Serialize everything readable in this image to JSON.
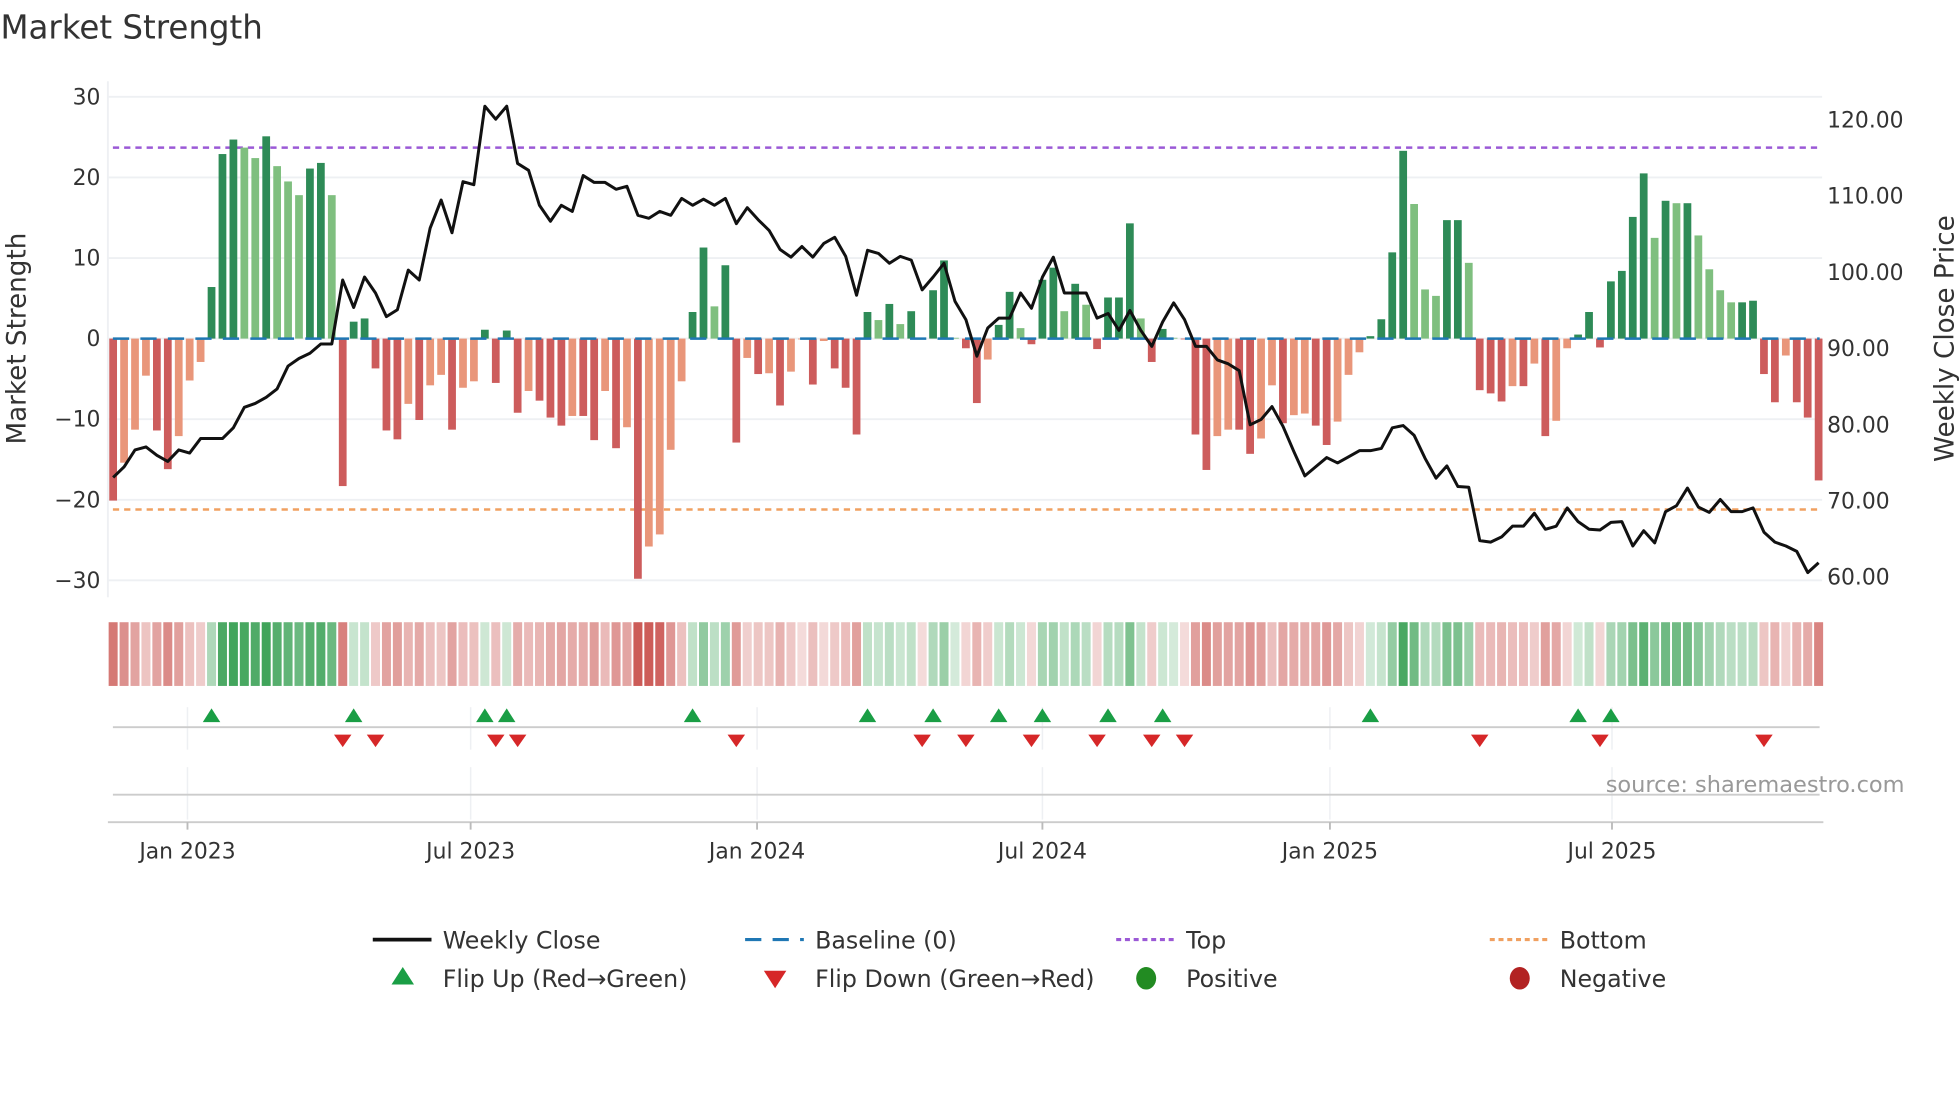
{
  "chart_data": {
    "type": "bar",
    "title": "Market Strength",
    "ylabel": "Market Strength",
    "y2label": "Weekly Close Price",
    "ylim": [
      -32,
      32
    ],
    "y2lim": [
      58,
      123
    ],
    "yticks": [
      30,
      20,
      10,
      0,
      -10,
      -20,
      -30
    ],
    "ytick_labels": [
      "30",
      "20",
      "10",
      "0",
      "−10",
      "−20",
      "−30"
    ],
    "y2ticks": [
      120,
      110,
      100,
      90,
      80,
      70,
      60
    ],
    "y2tick_labels": [
      "120.00",
      "110.00",
      "100.00",
      "90.00",
      "80.00",
      "70.00",
      "60.00"
    ],
    "x_unit": "week index",
    "xticks": [
      {
        "label": "Jan 2023",
        "week": 6.8
      },
      {
        "label": "Jul 2023",
        "week": 32.7
      },
      {
        "label": "Jan 2024",
        "week": 58.9
      },
      {
        "label": "Jul 2024",
        "week": 85.0
      },
      {
        "label": "Jan 2025",
        "week": 111.3
      },
      {
        "label": "Jul 2025",
        "week": 137.1
      }
    ],
    "grid": true,
    "top_level": 23.7,
    "bottom_level": -21.2,
    "baseline": 0,
    "strength": [
      -20.1,
      -15.4,
      -11.3,
      -4.6,
      -11.4,
      -16.2,
      -12.1,
      -5.2,
      -2.9,
      6.4,
      22.9,
      24.7,
      23.7,
      22.4,
      25.1,
      21.4,
      19.5,
      17.8,
      21.1,
      21.8,
      17.8,
      -18.3,
      2.1,
      2.5,
      -3.7,
      -11.4,
      -12.5,
      -8.1,
      -10.1,
      -5.8,
      -4.5,
      -11.3,
      -6.1,
      -5.3,
      1.1,
      -5.5,
      1.0,
      -9.2,
      -6.5,
      -7.7,
      -9.8,
      -10.8,
      -9.6,
      -9.6,
      -12.6,
      -6.5,
      -13.6,
      -11.0,
      -29.8,
      -25.8,
      -24.3,
      -13.8,
      -5.3,
      3.3,
      11.3,
      4.0,
      9.1,
      -12.9,
      -2.4,
      -4.4,
      -4.3,
      -8.3,
      -4.1,
      -0.1,
      -5.7,
      -0.3,
      -3.7,
      -6.1,
      -11.9,
      3.3,
      2.3,
      4.3,
      1.8,
      3.4,
      -0.1,
      6.0,
      9.7,
      0.1,
      -1.2,
      -8.0,
      -2.6,
      1.7,
      5.8,
      1.3,
      -0.7,
      7.3,
      8.8,
      3.4,
      6.8,
      4.2,
      -1.3,
      5.1,
      5.1,
      14.3,
      2.5,
      -2.9,
      1.2,
      0.1,
      -0.1,
      -11.9,
      -16.3,
      -12.1,
      -11.3,
      -11.3,
      -14.3,
      -12.4,
      -5.8,
      -10.5,
      -9.5,
      -9.3,
      -10.8,
      -13.2,
      -10.3,
      -4.5,
      -1.7,
      0.3,
      2.4,
      10.7,
      23.3,
      16.7,
      6.1,
      5.3,
      14.7,
      14.7,
      9.4,
      -6.4,
      -6.8,
      -7.8,
      -5.9,
      -5.9,
      -3.1,
      -12.1,
      -10.2,
      -1.2,
      0.5,
      3.3,
      -1.1,
      7.1,
      8.4,
      15.1,
      20.5,
      12.5,
      17.1,
      16.8,
      16.8,
      12.8,
      8.6,
      6.0,
      4.5,
      4.5,
      4.7,
      -4.4,
      -7.9,
      -2.1,
      -7.9,
      -9.8,
      -17.6
    ],
    "weekly_close": [
      73.1,
      74.5,
      76.7,
      77.1,
      76.0,
      75.2,
      76.7,
      76.3,
      78.2,
      78.2,
      78.2,
      79.6,
      82.3,
      82.8,
      83.6,
      84.7,
      87.7,
      88.7,
      89.4,
      90.6,
      90.6,
      99.0,
      95.4,
      99.4,
      97.3,
      94.2,
      95.1,
      100.3,
      99.0,
      105.8,
      109.5,
      105.2,
      111.9,
      111.5,
      121.8,
      120.1,
      121.8,
      114.3,
      113.4,
      108.8,
      106.7,
      108.8,
      108.0,
      112.7,
      111.8,
      111.8,
      110.9,
      111.3,
      107.5,
      107.1,
      108.0,
      107.5,
      109.7,
      108.8,
      109.6,
      108.8,
      109.7,
      106.4,
      108.5,
      106.9,
      105.5,
      103.0,
      102.0,
      103.4,
      102.0,
      103.8,
      104.6,
      102.1,
      97.0,
      102.9,
      102.5,
      101.2,
      102.1,
      101.6,
      97.7,
      99.4,
      101.2,
      96.2,
      93.8,
      89.0,
      92.7,
      94.0,
      94.0,
      97.3,
      95.3,
      99.4,
      102.0,
      97.3,
      97.3,
      97.3,
      94.0,
      94.6,
      92.4,
      95.0,
      92.4,
      90.3,
      93.5,
      96.0,
      93.8,
      90.3,
      90.3,
      88.5,
      88.0,
      87.1,
      80.0,
      80.7,
      82.4,
      79.8,
      76.5,
      73.3,
      74.5,
      75.7,
      75.0,
      75.8,
      76.6,
      76.6,
      76.9,
      79.6,
      79.9,
      78.6,
      75.6,
      73.0,
      74.6,
      71.9,
      71.8,
      64.8,
      64.6,
      65.3,
      66.7,
      66.7,
      68.4,
      66.3,
      66.7,
      69.1,
      67.3,
      66.3,
      66.2,
      67.2,
      67.3,
      64.1,
      66.1,
      64.5,
      68.6,
      69.4,
      71.7,
      69.2,
      68.5,
      70.2,
      68.6,
      68.6,
      69.1,
      65.9,
      64.6,
      64.1,
      63.4,
      60.6,
      61.9
    ],
    "legend": {
      "placement": "bottom",
      "items": [
        {
          "key": "close",
          "label": "Weekly Close"
        },
        {
          "key": "baseline",
          "label": "Baseline (0)"
        },
        {
          "key": "top",
          "label": "Top"
        },
        {
          "key": "bottom",
          "label": "Bottom"
        },
        {
          "key": "flip_up",
          "label": "Flip Up (Red→Green)"
        },
        {
          "key": "flip_down",
          "label": "Flip Down (Green→Red)"
        },
        {
          "key": "positive",
          "label": "Positive"
        },
        {
          "key": "negative",
          "label": "Negative"
        }
      ]
    },
    "source": "source: sharemaestro.com"
  },
  "colors": {
    "pos_strong": "#2e8b57",
    "pos_weak": "#7fbf7f",
    "neg_strong": "#cd5c5c",
    "neg_weak": "#e9967a",
    "close": "#111111",
    "baseline": "#1f77b4",
    "top": "#9b59d6",
    "bottom": "#f0a060",
    "flip_up": "#1a9e45",
    "flip_down": "#d62728",
    "positive_dot": "#228b22",
    "negative_dot": "#b22222",
    "strip_pos": "#3aa155",
    "strip_neg": "#cc5b57"
  }
}
